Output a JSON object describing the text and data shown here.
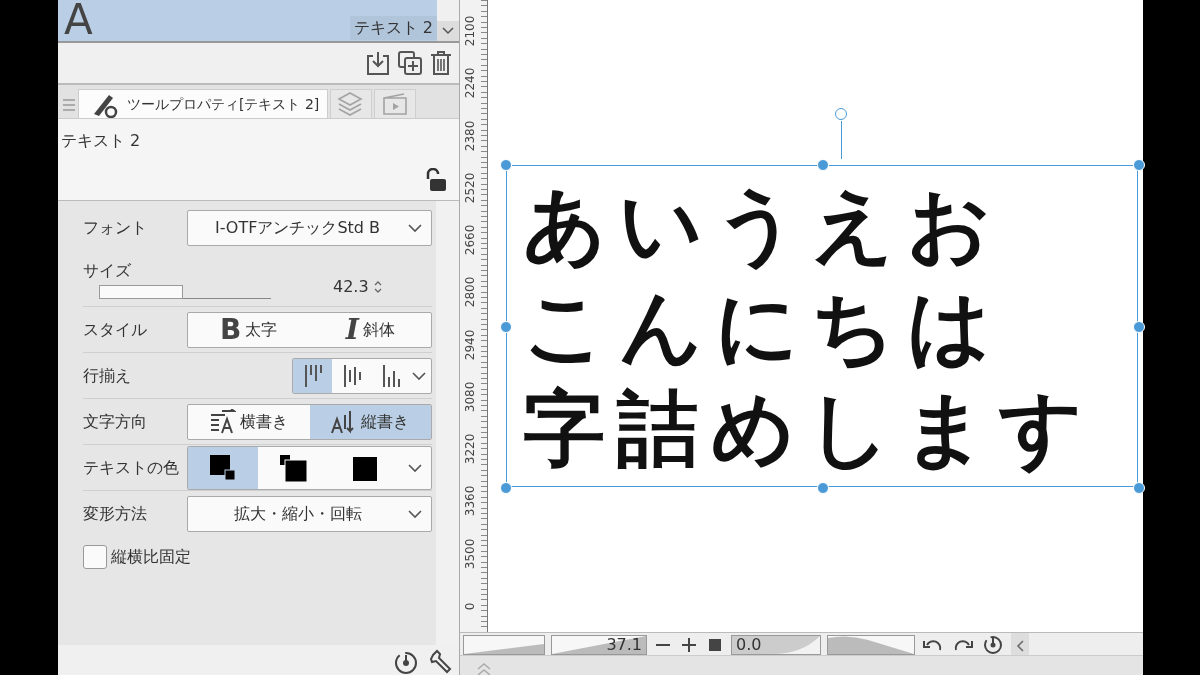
{
  "tool_header": {
    "icon_text": "A",
    "subtool": "テキスト 2"
  },
  "palette_tabs": [
    {
      "kind": "tool_property",
      "label": "ツールプロパティ[テキスト 2]",
      "selected": true
    },
    {
      "kind": "layer",
      "selected": false
    },
    {
      "kind": "animation",
      "selected": false
    }
  ],
  "tool_name": "テキスト 2",
  "locked": false,
  "properties": [
    {
      "kind": "dropdown",
      "label": "フォント",
      "value": "I-OTFアンチックStd B"
    },
    {
      "kind": "slider",
      "label": "サイズ",
      "value": "42.3",
      "level": 0.49
    },
    {
      "kind": "style",
      "label": "スタイル",
      "options": [
        {
          "icon_text": "B",
          "text": "太字",
          "selected": false
        },
        {
          "icon_text": "I",
          "text": "斜体",
          "selected": false
        }
      ]
    },
    {
      "kind": "align",
      "label": "行揃え",
      "options": [
        {
          "kind": "top",
          "selected": true
        },
        {
          "kind": "center",
          "selected": false
        },
        {
          "kind": "bottom",
          "selected": false
        }
      ]
    },
    {
      "kind": "direction",
      "label": "文字方向",
      "options": [
        {
          "kind": "horizontal",
          "text": "横書き",
          "selected": false
        },
        {
          "kind": "vertical",
          "text": "縦書き",
          "selected": true
        }
      ]
    },
    {
      "kind": "color",
      "label": "テキストの色",
      "options": [
        {
          "kind": "main",
          "selected": true
        },
        {
          "kind": "sub",
          "selected": false
        },
        {
          "kind": "user",
          "selected": false
        }
      ]
    },
    {
      "kind": "dropdown",
      "label": "変形方法",
      "value": "拡大・縮小・回転"
    },
    {
      "kind": "checkbox",
      "label": "縦横比固定",
      "checked": false
    }
  ],
  "ruler_labels": [
    "2100",
    "2240",
    "2380",
    "2520",
    "2660",
    "2800",
    "2940",
    "3080",
    "3220",
    "3360",
    "3500",
    "0"
  ],
  "canvas": {
    "lines": [
      "あいうえお",
      "こんにちは",
      "字詰めします"
    ]
  },
  "navigator": {
    "zoom_slider": {
      "level": 1
    },
    "zoom": "37.1",
    "rotation": "0.0",
    "rotation_slider": {
      "level": 1
    }
  }
}
